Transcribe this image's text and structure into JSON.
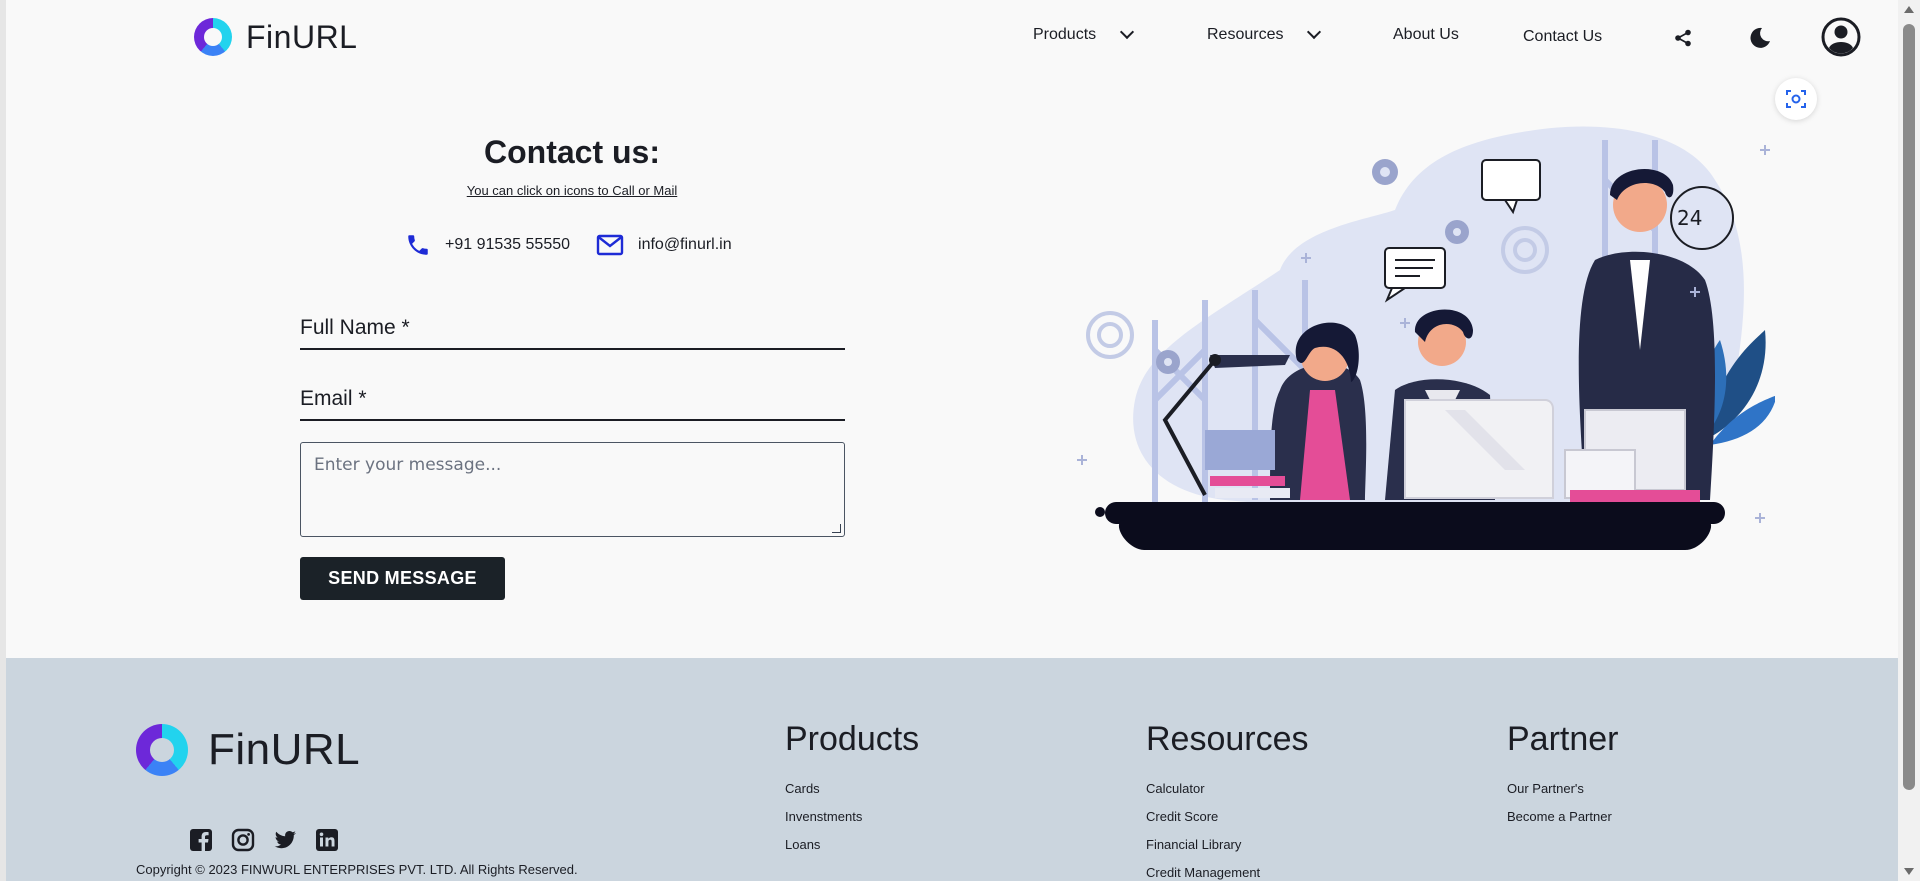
{
  "header": {
    "brand": "FinURL",
    "nav": {
      "products": "Products",
      "resources": "Resources",
      "about": "About Us",
      "contact": "Contact Us"
    },
    "icons": [
      "share-icon",
      "moon-icon",
      "user-icon",
      "scan-icon"
    ]
  },
  "contact": {
    "title": "Contact us:",
    "hint": "You can click on icons to Call or Mail",
    "phone": "+91 91535 55550",
    "email": "info@finurl.in",
    "fields": {
      "full_name": "Full Name *",
      "email": "Email *",
      "message_placeholder": "Enter your message..."
    },
    "send_label": "SEND MESSAGE",
    "illustration_text": "24"
  },
  "footer": {
    "brand": "FinURL",
    "social_icons": [
      "facebook-icon",
      "instagram-icon",
      "twitter-icon",
      "linkedin-icon"
    ],
    "copyright": "Copyright © 2023 FINWURL ENTERPRISES PVT. LTD. All Rights Reserved.",
    "columns": {
      "products": {
        "title": "Products",
        "links": [
          "Cards",
          "Invenstments",
          "Loans"
        ]
      },
      "resources": {
        "title": "Resources",
        "links": [
          "Calculator",
          "Credit Score",
          "Financial Library",
          "Credit Management"
        ]
      },
      "partner": {
        "title": "Partner",
        "links": [
          "Our Partner's",
          "Become a Partner"
        ]
      }
    }
  },
  "colors": {
    "accent_dark": "#1b2228",
    "footer_bg": "#cbd5de",
    "icon_blue": "#1e2bd6",
    "logo_cyan": "#22d3ee",
    "logo_purple": "#6d28d9"
  }
}
